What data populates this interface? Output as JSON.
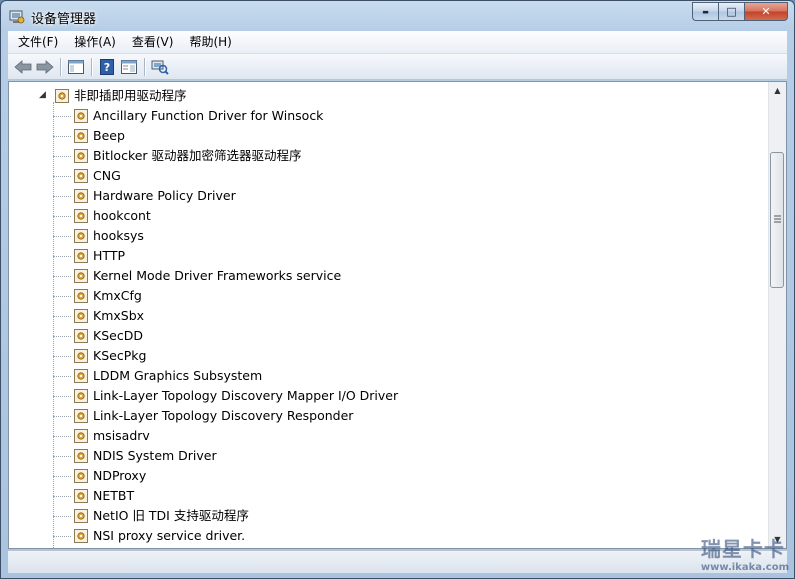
{
  "window": {
    "title": "设备管理器"
  },
  "caption_buttons": {
    "minimize": "▬",
    "maximize": "□",
    "close": "✕"
  },
  "menu": [
    "文件(F)",
    "操作(A)",
    "查看(V)",
    "帮助(H)"
  ],
  "toolbar": [
    "back-icon",
    "forward-icon",
    "sep",
    "show-hide-console-tree-icon",
    "sep",
    "help-icon",
    "properties-pane-icon",
    "sep",
    "scan-hardware-changes-icon"
  ],
  "tree": {
    "category": {
      "label": "非即插即用驱动程序",
      "expanded": true
    },
    "items": [
      "Ancillary Function Driver for Winsock",
      "Beep",
      "Bitlocker 驱动器加密筛选器驱动程序",
      "CNG",
      "Hardware Policy Driver",
      "hookcont",
      "hooksys",
      "HTTP",
      "Kernel Mode Driver Frameworks service",
      "KmxCfg",
      "KmxSbx",
      "KSecDD",
      "KSecPkg",
      "LDDM Graphics Subsystem",
      "Link-Layer Topology Discovery Mapper I/O Driver",
      "Link-Layer Topology Discovery Responder",
      "msisadrv",
      "NDIS System Driver",
      "NDProxy",
      "NETBT",
      "NetIO 旧 TDI 支持驱动程序",
      "NSI proxy service driver."
    ]
  },
  "scrollbar": {
    "up": "▲",
    "down": "▼",
    "position": 0.22,
    "visible_fraction": 0.3
  },
  "watermark": {
    "line1": "瑞星卡卡",
    "line2": "www.ikaka.com"
  },
  "colors": {
    "title_bar": "#b5cde6",
    "close_button": "#c0432a",
    "content_bg": "#ffffff"
  }
}
